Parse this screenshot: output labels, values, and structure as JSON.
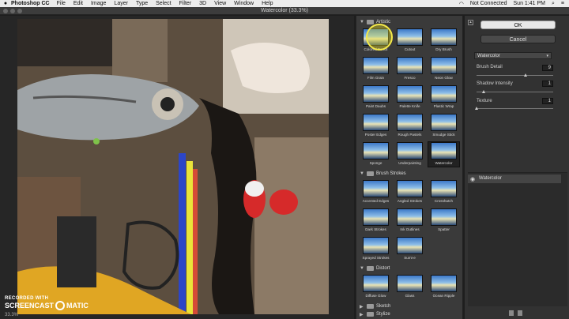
{
  "menubar": {
    "app_name": "Photoshop CC",
    "items": [
      "File",
      "Edit",
      "Image",
      "Layer",
      "Type",
      "Select",
      "Filter",
      "3D",
      "View",
      "Window",
      "Help"
    ],
    "wifi_status": "Not Connected",
    "clock": "Sun 1:41 PM"
  },
  "dialog": {
    "title": "Watercolor (33.3%)"
  },
  "preview": {
    "zoom": "33.3%"
  },
  "watermark": {
    "line1": "RECORDED WITH",
    "line2_a": "SCREENCAST",
    "line2_b": "MATIC"
  },
  "gallery": {
    "categories": [
      {
        "name": "Artistic",
        "expanded": true,
        "filters": [
          "Colored Pencil",
          "Cutout",
          "Dry Brush",
          "Film Grain",
          "Fresco",
          "Neon Glow",
          "Paint Daubs",
          "Palette Knife",
          "Plastic Wrap",
          "Poster Edges",
          "Rough Pastels",
          "Smudge Stick",
          "Sponge",
          "Underpainting",
          "Watercolor"
        ],
        "selected": "Watercolor"
      },
      {
        "name": "Brush Strokes",
        "expanded": true,
        "filters": [
          "Accented Edges",
          "Angled Strokes",
          "Crosshatch",
          "Dark Strokes",
          "Ink Outlines",
          "Spatter",
          "Sprayed Strokes",
          "Sumi-e"
        ]
      },
      {
        "name": "Distort",
        "expanded": true,
        "filters": [
          "Diffuse Glow",
          "Glass",
          "Ocean Ripple"
        ]
      },
      {
        "name": "Sketch",
        "expanded": false,
        "filters": []
      },
      {
        "name": "Stylize",
        "expanded": false,
        "filters": []
      }
    ]
  },
  "panel": {
    "ok_label": "OK",
    "cancel_label": "Cancel",
    "filter_select": "Watercolor",
    "params": [
      {
        "label": "Brush Detail",
        "value": "9",
        "fraction": 0.64
      },
      {
        "label": "Shadow Intensity",
        "value": "1",
        "fraction": 0.1
      },
      {
        "label": "Texture",
        "value": "1",
        "fraction": 0.0
      }
    ],
    "layer_name": "Watercolor"
  },
  "colors": {
    "accent_cursor": "#f4e94a",
    "panel_bg": "#323232",
    "gallery_bg": "#3a3a3a"
  }
}
